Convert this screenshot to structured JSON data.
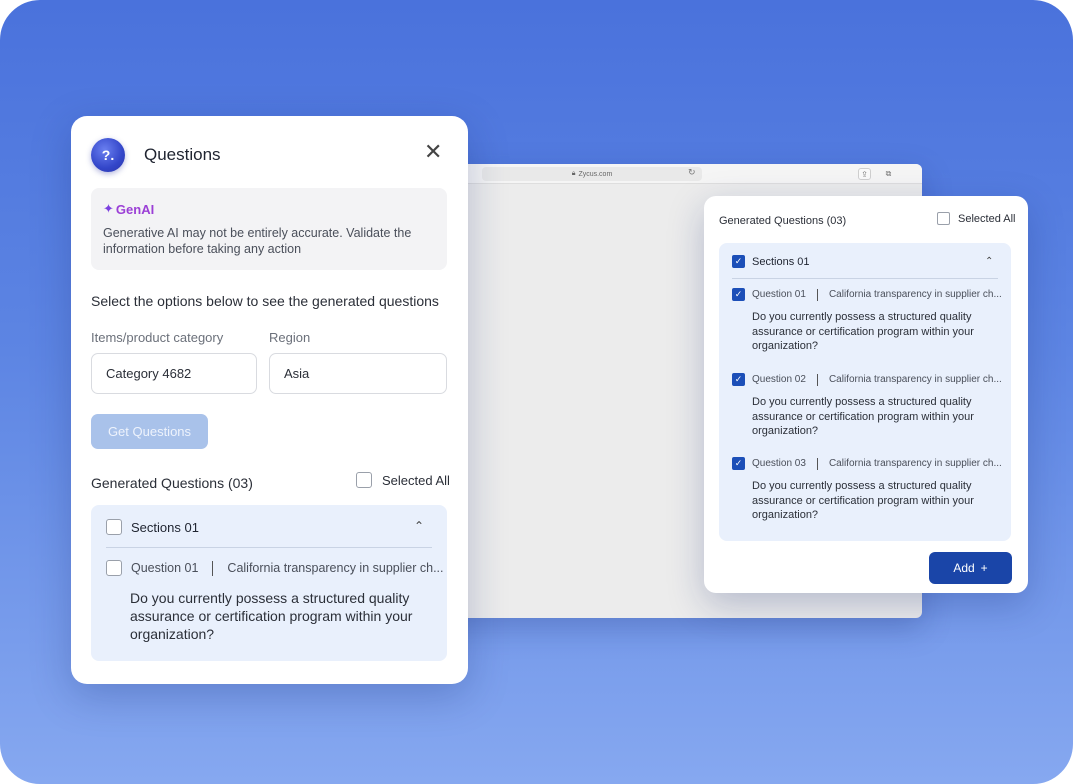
{
  "browser": {
    "url": "Zycus.com"
  },
  "dialog": {
    "avatar_glyph": "?.",
    "title": "Questions",
    "close_glyph": "✕",
    "genai": {
      "label": "GenAI",
      "sparkle_glyph": "✦",
      "disclaimer": "Generative AI may not be entirely accurate. Validate the information before taking any action"
    },
    "instructions": "Select the options below to see the generated questions",
    "category": {
      "label": "Items/product category",
      "value": "Category 4682"
    },
    "region": {
      "label": "Region",
      "value": "Asia"
    },
    "get_button": "Get Questions",
    "generated_title": "Generated Questions (03)",
    "select_all_label": "Selected All",
    "section": {
      "title": "Sections 01",
      "checked": false,
      "questions": [
        {
          "number": "Question 01",
          "category": "California transparency in supplier ch...",
          "text": "Do you currently possess a structured quality assurance or certification program within your organization?",
          "checked": false
        }
      ]
    }
  },
  "generated_panel": {
    "title": "Generated Questions (03)",
    "select_all_label": "Selected All",
    "section": {
      "title": "Sections 01",
      "checked": true,
      "questions": [
        {
          "number": "Question 01",
          "category": "California transparency in supplier ch...",
          "text": "Do you currently possess a structured quality assurance or certification program within your organization?",
          "checked": true
        },
        {
          "number": "Question 02",
          "category": "California transparency in supplier ch...",
          "text": "Do you currently possess a structured quality assurance or certification program within your organization?",
          "checked": true
        },
        {
          "number": "Question 03",
          "category": "California transparency in supplier ch...",
          "text": "Do you currently possess a structured quality assurance or certification program within your organization?",
          "checked": true
        }
      ]
    },
    "add_button": "Add",
    "add_glyph": "+"
  },
  "colors": {
    "primary": "#1a45a8",
    "genai_accent": "#9b3fd6",
    "section_bg": "#e9f0fc",
    "disabled_button": "#a9c2ea"
  }
}
